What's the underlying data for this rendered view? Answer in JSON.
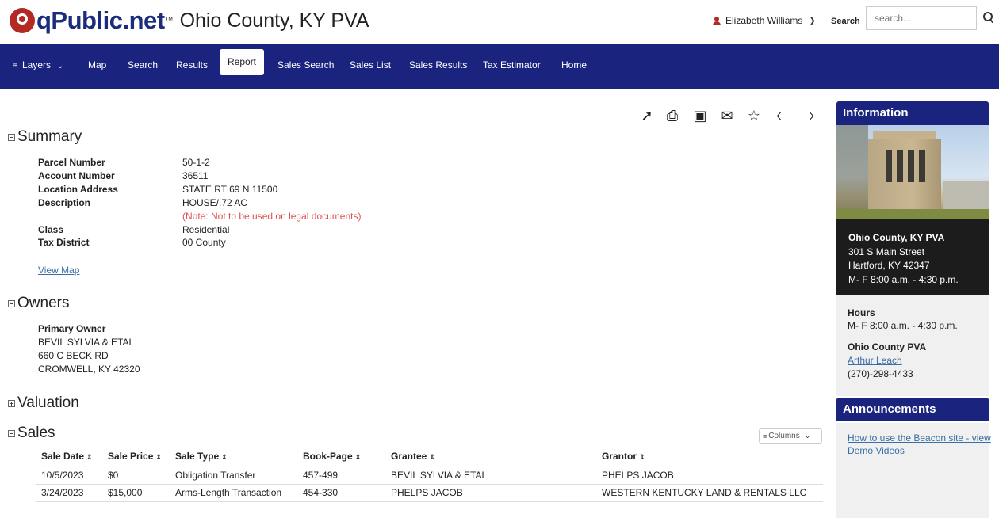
{
  "header": {
    "logo_text": "qPublic.net",
    "logo_tm": "™",
    "county_title": "Ohio County, KY PVA",
    "user_name": "Elizabeth Williams",
    "search_label": "Search",
    "search_placeholder": "search..."
  },
  "nav": {
    "items": [
      {
        "label": "Layers"
      },
      {
        "label": "Map"
      },
      {
        "label": "Search"
      },
      {
        "label": "Results"
      },
      {
        "label": "Report"
      },
      {
        "label": "Sales Search"
      },
      {
        "label": "Sales List"
      },
      {
        "label": "Sales Results"
      },
      {
        "label": "Tax Estimator"
      },
      {
        "label": "Home"
      }
    ],
    "active": "Report"
  },
  "toolbar": {
    "icons": [
      "share-icon",
      "print-icon",
      "image-icon",
      "email-icon",
      "star-icon",
      "arrow-left-icon",
      "arrow-right-icon"
    ]
  },
  "summary": {
    "title": "Summary",
    "rows": [
      {
        "label": "Parcel Number",
        "value": "50-1-2"
      },
      {
        "label": "Account Number",
        "value": "36511"
      },
      {
        "label": "Location Address",
        "value": "STATE RT 69 N 11500"
      },
      {
        "label": "Description",
        "value": "HOUSE/.72 AC"
      },
      {
        "label": "Class",
        "value": "Residential"
      },
      {
        "label": "Tax District",
        "value": "00 County"
      }
    ],
    "note": "(Note: Not to be used on legal documents)",
    "view_map": "View Map"
  },
  "owners": {
    "title": "Owners",
    "primary_label": "Primary Owner",
    "lines": [
      "BEVIL SYLVIA & ETAL",
      "660 C BECK RD",
      "CROMWELL, KY 42320"
    ]
  },
  "valuation": {
    "title": "Valuation"
  },
  "sales": {
    "title": "Sales",
    "columns_button": "Columns",
    "headers": [
      "Sale Date",
      "Sale Price",
      "Sale Type",
      "Book-Page",
      "Grantee",
      "Grantor"
    ],
    "rows": [
      [
        "10/5/2023",
        "$0",
        "Obligation Transfer",
        "457-499",
        "BEVIL SYLVIA & ETAL",
        "PHELPS JACOB"
      ],
      [
        "3/24/2023",
        "$15,000",
        "Arms-Length Transaction",
        "454-330",
        "PHELPS JACOB",
        "WESTERN KENTUCKY LAND & RENTALS LLC"
      ]
    ]
  },
  "information": {
    "title": "Information",
    "office_lines": [
      "Ohio County, KY PVA",
      "301 S Main Street",
      "Hartford, KY 42347",
      "M- F 8:00 a.m. - 4:30 p.m."
    ],
    "hours_label": "Hours",
    "hours_value": "M- F 8:00 a.m. - 4:30 p.m.",
    "pva_label": "Ohio County PVA",
    "pva_name": "Arthur Leach",
    "pva_phone": "(270)-298-4433"
  },
  "announcements": {
    "title": "Announcements",
    "link_line1": "How to use the Beacon site - view",
    "link_line2": "Demo Videos"
  },
  "colors": {
    "nav_bg": "#1a237e",
    "brand_red": "#b22a23",
    "link": "#3a6ea5",
    "note_red": "#d9534f"
  }
}
